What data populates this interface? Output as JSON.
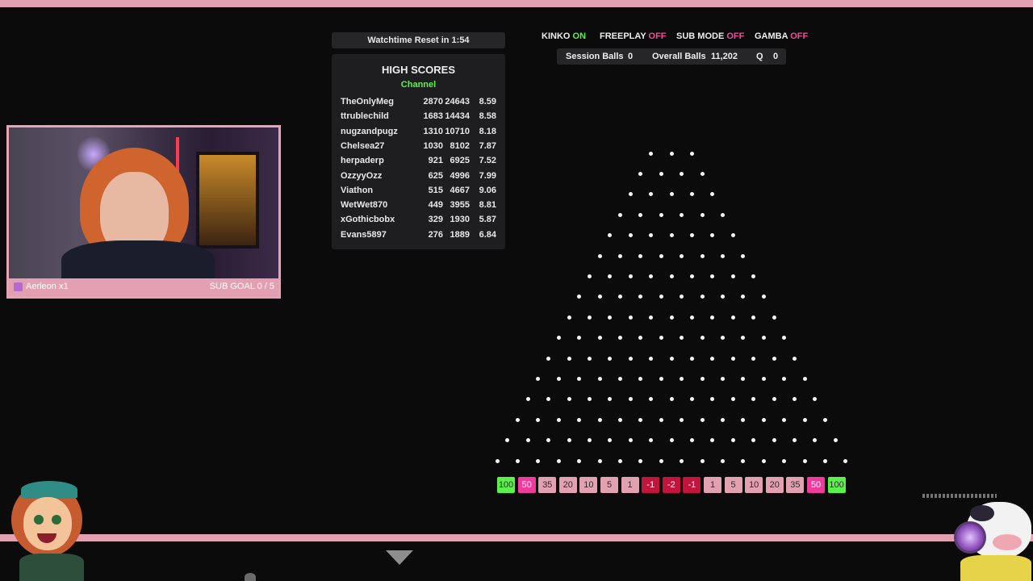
{
  "watchtime": "Watchtime Reset in 1:54",
  "high_scores": {
    "title": "HIGH SCORES",
    "subtitle": "Channel",
    "rows": [
      {
        "name": "TheOnlyMeg",
        "a": "2870",
        "b": "24643",
        "c": "8.59"
      },
      {
        "name": "ttrublechild",
        "a": "1683",
        "b": "14434",
        "c": "8.58"
      },
      {
        "name": "nugzandpugz",
        "a": "1310",
        "b": "10710",
        "c": "8.18"
      },
      {
        "name": "Chelsea27",
        "a": "1030",
        "b": "8102",
        "c": "7.87"
      },
      {
        "name": "herpaderp",
        "a": "921",
        "b": "6925",
        "c": "7.52"
      },
      {
        "name": "OzzyyOzz",
        "a": "625",
        "b": "4996",
        "c": "7.99"
      },
      {
        "name": "Viathon",
        "a": "515",
        "b": "4667",
        "c": "9.06"
      },
      {
        "name": "WetWet870",
        "a": "449",
        "b": "3955",
        "c": "8.81"
      },
      {
        "name": "xGothicbobx",
        "a": "329",
        "b": "1930",
        "c": "5.87"
      },
      {
        "name": "Evans5897",
        "a": "276",
        "b": "1889",
        "c": "6.84"
      }
    ]
  },
  "modes": [
    {
      "label": "KINKO",
      "state": "ON"
    },
    {
      "label": "FREEPLAY",
      "state": "OFF"
    },
    {
      "label": "SUB MODE",
      "state": "OFF"
    },
    {
      "label": "GAMBA",
      "state": "OFF"
    }
  ],
  "counts": {
    "session_label": "Session Balls",
    "session_value": "0",
    "overall_label": "Overall Balls",
    "overall_value": "11,202",
    "q_label": "Q",
    "q_value": "0"
  },
  "webcam": {
    "user_label": "Aerleon x1",
    "goal_label": "SUB GOAL 0 / 5"
  },
  "plinko": {
    "slots": [
      {
        "label": "100",
        "color": "#5cf04a"
      },
      {
        "label": "50",
        "color": "#ef3c9c"
      },
      {
        "label": "35",
        "color": "#e3a0b1"
      },
      {
        "label": "20",
        "color": "#e3a0b1"
      },
      {
        "label": "10",
        "color": "#e3a0b1"
      },
      {
        "label": "5",
        "color": "#e3a0b1"
      },
      {
        "label": "1",
        "color": "#e3a0b1"
      },
      {
        "label": "-1",
        "color": "#c2153e"
      },
      {
        "label": "-2",
        "color": "#c2153e"
      },
      {
        "label": "-1",
        "color": "#c2153e"
      },
      {
        "label": "1",
        "color": "#e3a0b1"
      },
      {
        "label": "5",
        "color": "#e3a0b1"
      },
      {
        "label": "10",
        "color": "#e3a0b1"
      },
      {
        "label": "20",
        "color": "#e3a0b1"
      },
      {
        "label": "35",
        "color": "#e3a0b1"
      },
      {
        "label": "50",
        "color": "#ef3c9c"
      },
      {
        "label": "100",
        "color": "#5cf04a"
      }
    ]
  },
  "colors": {
    "accent_pink": "#e3a0b1",
    "on_green": "#5cf04a",
    "off_pink": "#ef4d9a"
  }
}
